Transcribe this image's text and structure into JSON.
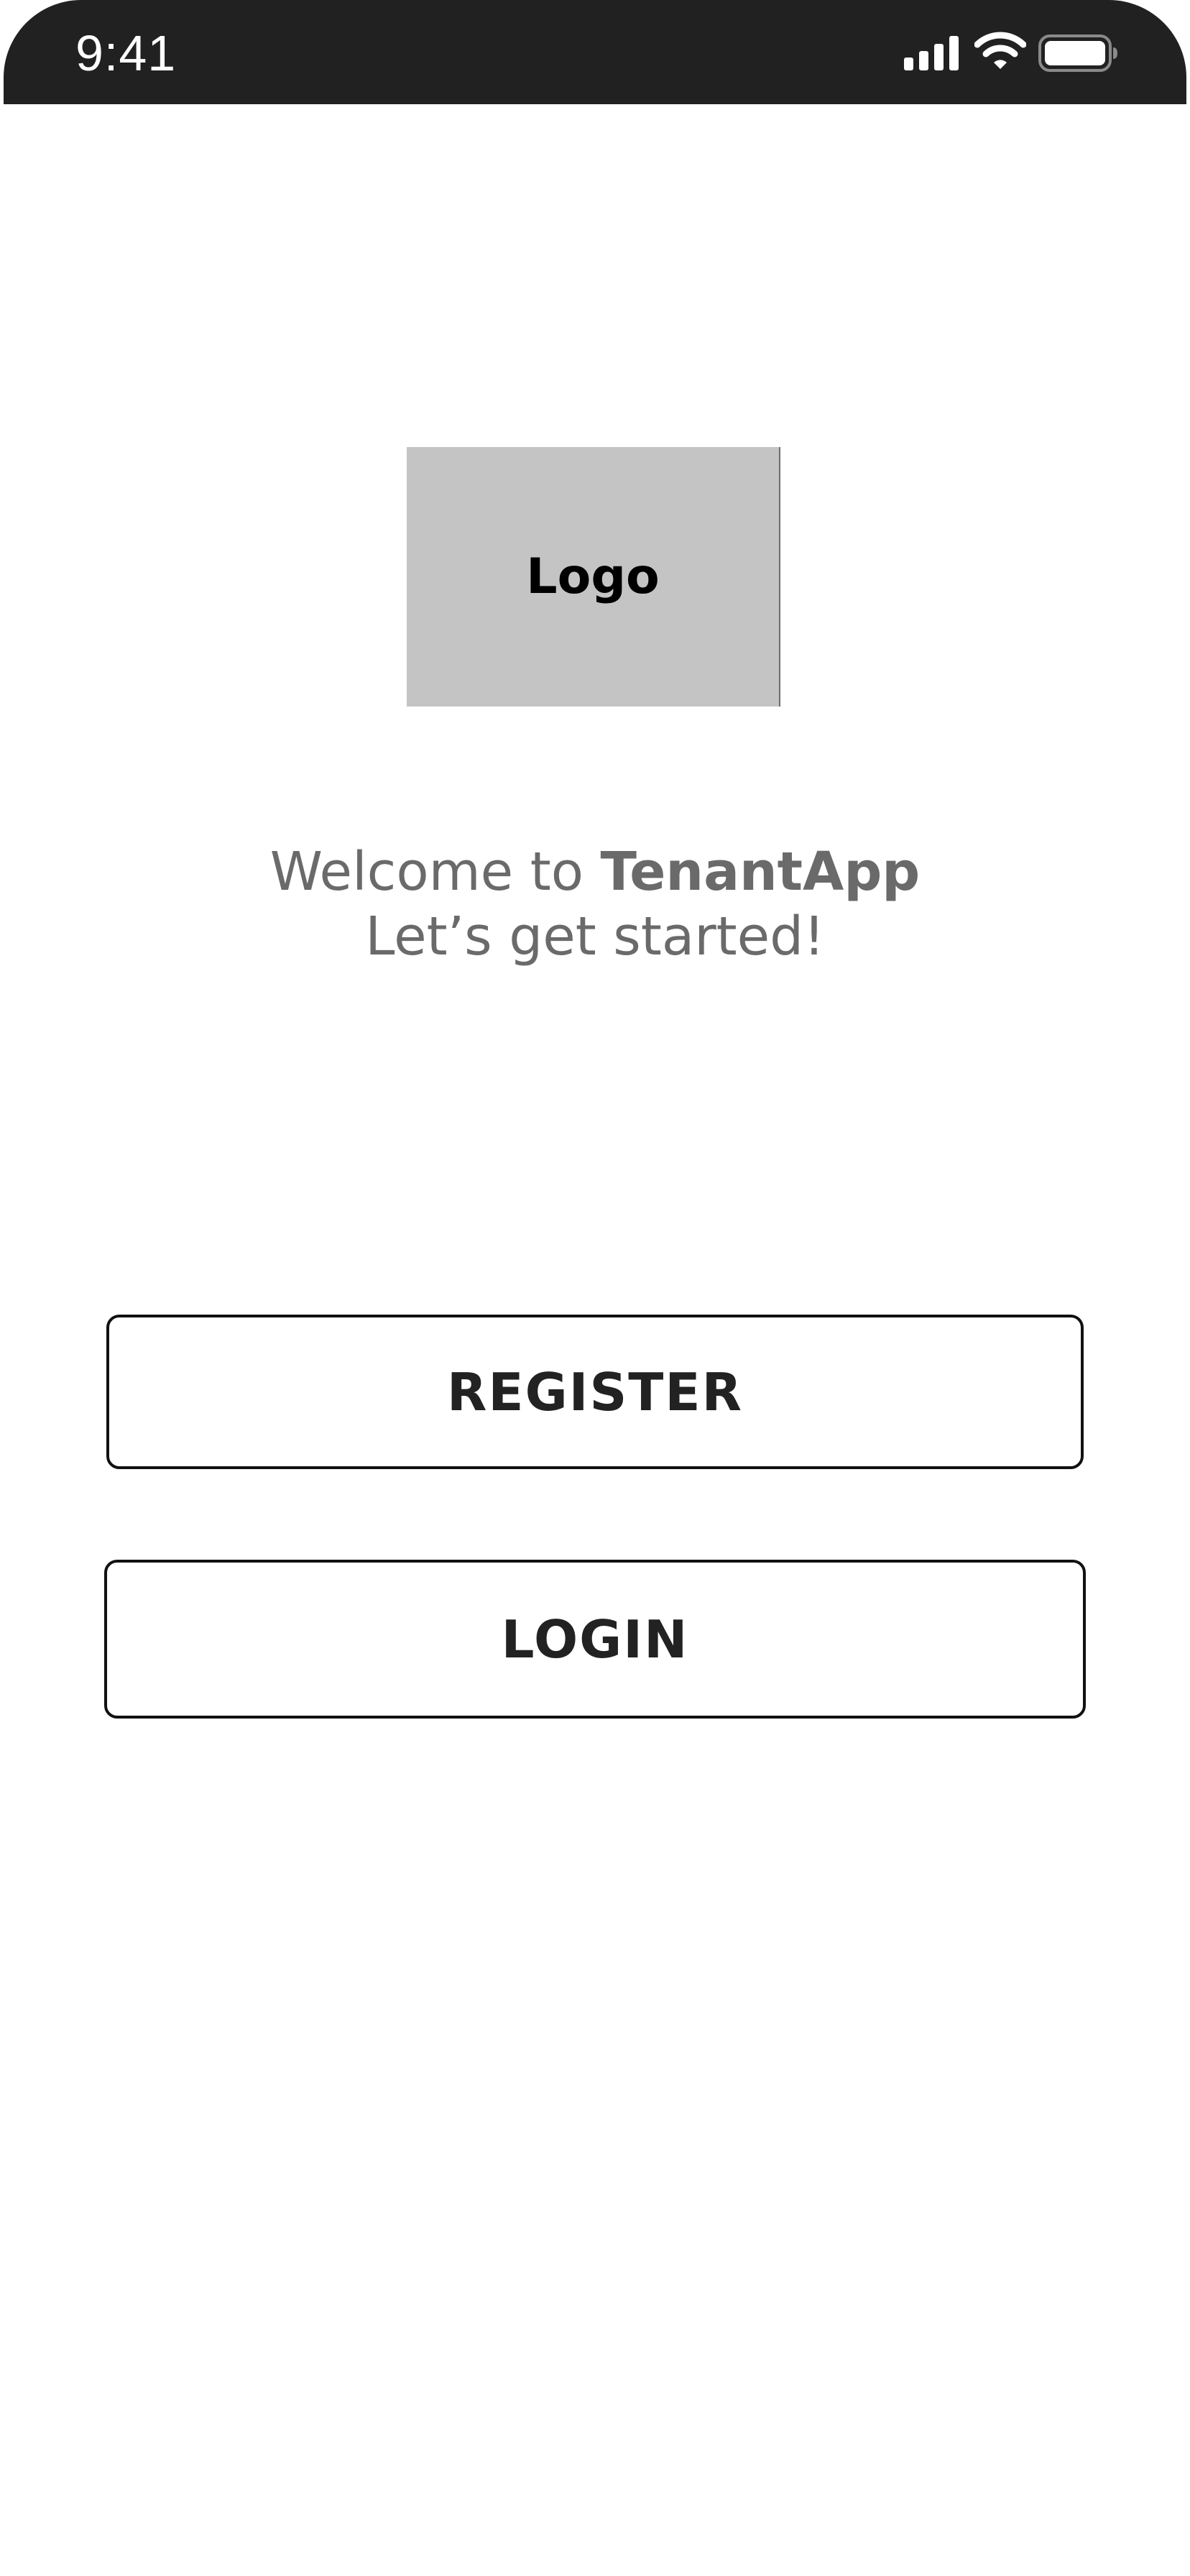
{
  "status_bar": {
    "time": "9:41",
    "icons": [
      "cellular-signal-icon",
      "wifi-icon",
      "battery-icon"
    ],
    "background_color": "#212121"
  },
  "logo": {
    "label": "Logo",
    "background_color": "#c4c4c4"
  },
  "welcome": {
    "prefix": "Welcome to ",
    "app_name": "TenantApp",
    "subtitle": "Let’s get started!",
    "text_color": "#6a6a6a"
  },
  "actions": {
    "register_label": "REGISTER",
    "login_label": "LOGIN"
  }
}
